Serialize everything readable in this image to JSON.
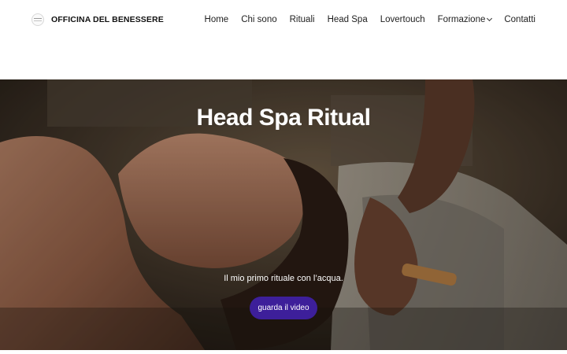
{
  "brand": {
    "name": "OFFICINA DEL BENESSERE",
    "logo_icon": "leaf-logo-icon"
  },
  "nav": {
    "items": [
      {
        "label": "Home"
      },
      {
        "label": "Chi sono"
      },
      {
        "label": "Rituali"
      },
      {
        "label": "Head Spa"
      },
      {
        "label": "Lovertouch"
      },
      {
        "label": "Formazione",
        "has_dropdown": true
      },
      {
        "label": "Contatti"
      }
    ]
  },
  "hero": {
    "title": "Head Spa Ritual",
    "subtitle": "Il mio primo rituale con l’acqua.",
    "button_label": "guarda il video",
    "button_color": "#3d1f9a"
  }
}
